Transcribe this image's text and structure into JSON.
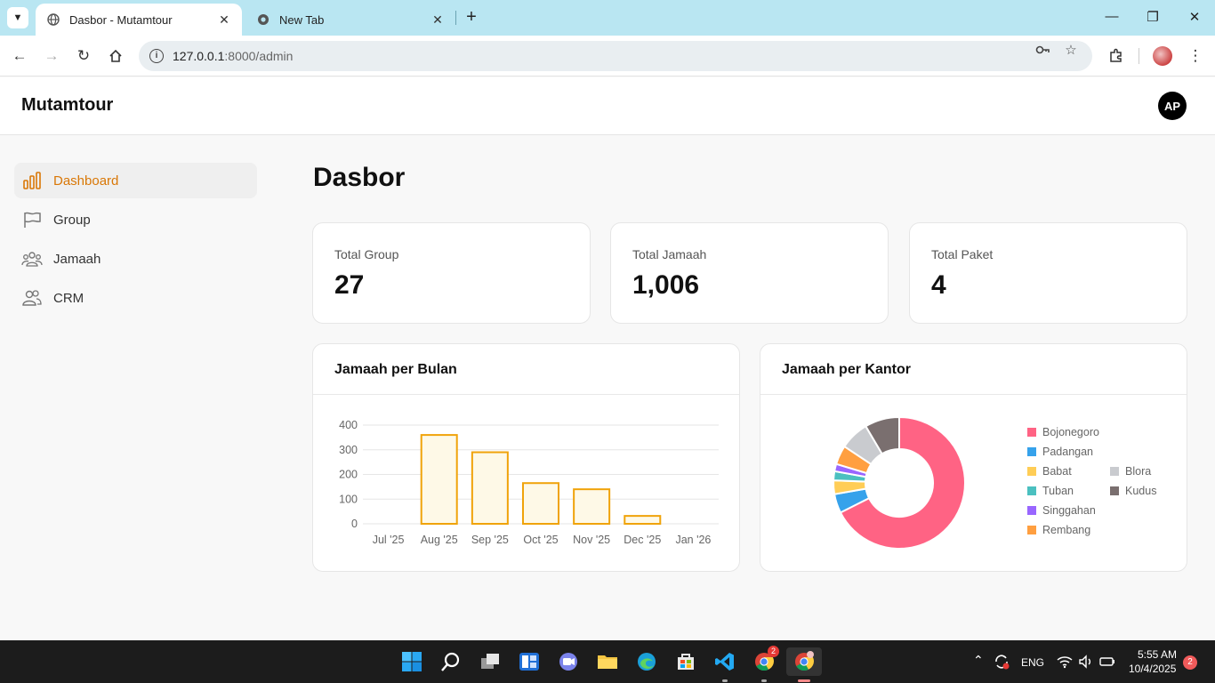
{
  "browser": {
    "tabs": [
      {
        "title": "Dasbor - Mutamtour",
        "active": true
      },
      {
        "title": "New Tab",
        "active": false
      }
    ],
    "url_host": "127.0.0.1",
    "url_path": ":8000/admin"
  },
  "app": {
    "brand": "Mutamtour",
    "user_initials": "AP"
  },
  "sidebar": {
    "items": [
      {
        "label": "Dashboard",
        "icon": "bar-chart-icon",
        "active": true
      },
      {
        "label": "Group",
        "icon": "flag-icon",
        "active": false
      },
      {
        "label": "Jamaah",
        "icon": "users-icon",
        "active": false
      },
      {
        "label": "CRM",
        "icon": "user-group-icon",
        "active": false
      }
    ]
  },
  "page": {
    "title": "Dasbor"
  },
  "stats": [
    {
      "label": "Total Group",
      "value": "27"
    },
    {
      "label": "Total Jamaah",
      "value": "1,006"
    },
    {
      "label": "Total Paket",
      "value": "4"
    }
  ],
  "colors": {
    "accent": "#d97706",
    "bar_fill": "#fef9e7",
    "bar_stroke": "#f0a30a"
  },
  "chart_data": [
    {
      "type": "bar",
      "title": "Jamaah per Bulan",
      "categories": [
        "Jul '25",
        "Aug '25",
        "Sep '25",
        "Oct '25",
        "Nov '25",
        "Dec '25",
        "Jan '26"
      ],
      "values": [
        0,
        360,
        290,
        165,
        140,
        32,
        0
      ],
      "ylim": [
        0,
        400
      ],
      "yticks": [
        0,
        100,
        200,
        300,
        400
      ],
      "grid": true
    },
    {
      "type": "pie",
      "title": "Jamaah per Kantor",
      "labels": [
        "Bojonegoro",
        "Padangan",
        "Babat",
        "Tuban",
        "Singgahan",
        "Rembang",
        "Blora",
        "Kudus"
      ],
      "values": [
        604,
        42,
        30,
        20,
        16,
        42,
        64,
        76
      ],
      "colors": [
        "#ff6384",
        "#36a2eb",
        "#ffcd56",
        "#4bc0c0",
        "#9966ff",
        "#ff9f40",
        "#c9cbcf",
        "#7a6f6f"
      ],
      "legend": "right"
    }
  ],
  "taskbar": {
    "lang": "ENG",
    "time": "5:55 AM",
    "date": "10/4/2025",
    "notifications": "2",
    "chrome_badge": "2"
  }
}
